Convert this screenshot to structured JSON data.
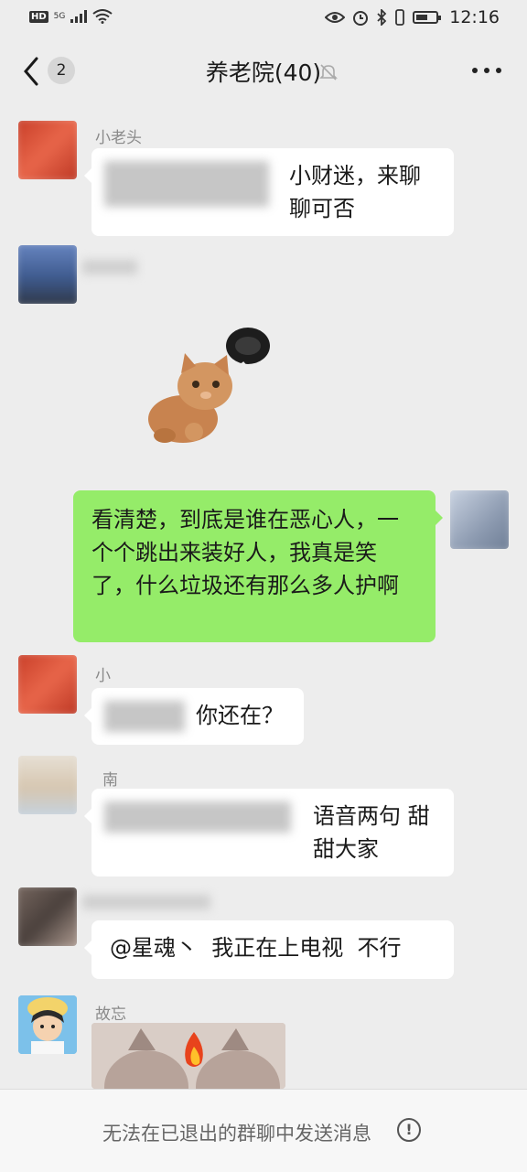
{
  "status_bar": {
    "network": "HD",
    "signal": "5G",
    "time": "12:16"
  },
  "nav": {
    "back_count": "2",
    "title": "养老院(40)"
  },
  "messages": [
    {
      "sender": "小老头",
      "text": "小财迷，来聊聊可否"
    },
    {
      "sender": "",
      "type": "sticker"
    },
    {
      "sender": "me",
      "text": "看清楚，到底是谁在恶心人，一个个跳出来装好人，我真是笑了，什么垃圾还有那么多人护啊"
    },
    {
      "sender": "小",
      "text": "你还在？"
    },
    {
      "sender": "南",
      "text": "语音两句 甜甜大家"
    },
    {
      "sender": "",
      "text": "@星魂丶  我正在上电视  不行"
    },
    {
      "sender": "故忘",
      "type": "image"
    }
  ],
  "footer": {
    "notice": "无法在已退出的群聊中发送消息",
    "icon": "exclamation-circle-icon"
  },
  "colors": {
    "background": "#ededed",
    "my_bubble": "#95ec69",
    "other_bubble": "#ffffff"
  }
}
